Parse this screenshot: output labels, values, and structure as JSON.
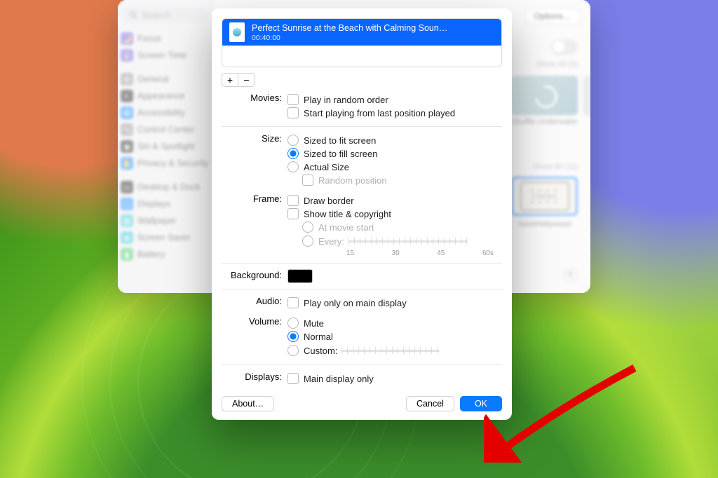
{
  "sidebar": {
    "search_placeholder": "Search",
    "items": [
      {
        "label": "Focus",
        "icon": "🌙",
        "bg": "#6e5ce6"
      },
      {
        "label": "Screen Time",
        "icon": "⌛",
        "bg": "#6e5ce6"
      },
      {
        "gap": true
      },
      {
        "label": "General",
        "icon": "⚙",
        "bg": "#8e8e93"
      },
      {
        "label": "Appearance",
        "icon": "◐",
        "bg": "#1c1c1e"
      },
      {
        "label": "Accessibility",
        "icon": "✪",
        "bg": "#0a84ff"
      },
      {
        "label": "Control Center",
        "icon": "⌥",
        "bg": "#8e8e93"
      },
      {
        "label": "Siri & Spotlight",
        "icon": "◉",
        "bg": "#1c1c1e"
      },
      {
        "label": "Privacy & Security",
        "icon": "✋",
        "bg": "#0a84ff"
      },
      {
        "gap": true
      },
      {
        "label": "Desktop & Dock",
        "icon": "▭",
        "bg": "#1c1c1e"
      },
      {
        "label": "Displays",
        "icon": "▢",
        "bg": "#0a84ff"
      },
      {
        "label": "Wallpaper",
        "icon": "▧",
        "bg": "#34c1d6"
      },
      {
        "label": "Screen Saver",
        "icon": "◈",
        "bg": "#34c1d6"
      },
      {
        "label": "Battery",
        "icon": "▮",
        "bg": "#34c759"
      }
    ]
  },
  "rightPane": {
    "options": "Options…",
    "show_all_top": "Show All (5)",
    "thumb1_caption": "Shuffle Underwater",
    "show_all_bottom": "Show All (11)",
    "thumb2_label": "CINEMA",
    "thumb2_caption": "SaveHollywood",
    "help": "?"
  },
  "modal": {
    "file_title": "Perfect Sunrise at the Beach with Calming Soun…",
    "file_duration": "00:40:00",
    "labels": {
      "movies": "Movies:",
      "size": "Size:",
      "frame": "Frame:",
      "background": "Background:",
      "audio": "Audio:",
      "volume": "Volume:",
      "displays": "Displays:"
    },
    "movies_opts": {
      "random": "Play in random order",
      "resume": "Start playing from last position played"
    },
    "size_opts": {
      "fit": "Sized to fit screen",
      "fill": "Sized to fill screen",
      "actual": "Actual Size",
      "randpos": "Random position"
    },
    "frame_opts": {
      "border": "Draw border",
      "title": "Show title & copyright",
      "atstart": "At movie start",
      "every": "Every:"
    },
    "tick_labels": [
      "15",
      "30",
      "45",
      "60s"
    ],
    "audio_opts": {
      "mainonly": "Play only on main display"
    },
    "volume_opts": {
      "mute": "Mute",
      "normal": "Normal",
      "custom": "Custom:"
    },
    "display_opts": {
      "mainonly": "Main display only"
    },
    "buttons": {
      "about": "About…",
      "cancel": "Cancel",
      "ok": "OK"
    }
  }
}
